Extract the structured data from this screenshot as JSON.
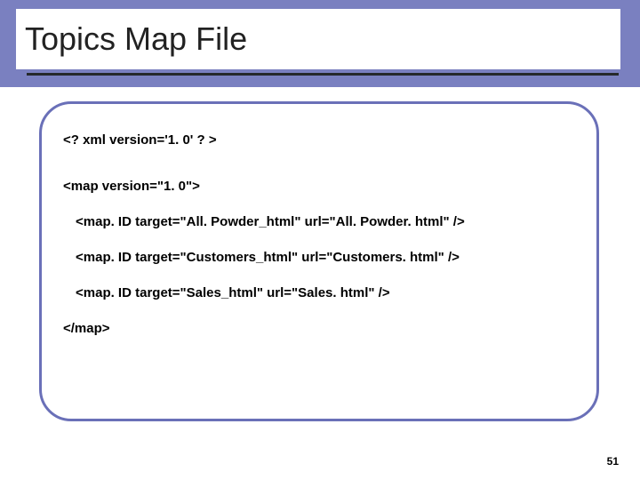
{
  "slide": {
    "title": "Topics Map File",
    "page_number": "51"
  },
  "code": {
    "l1": "<? xml version='1. 0' ? >",
    "l2": "<map version=\"1. 0\">",
    "l3": "<map. ID target=\"All. Powder_html\" url=\"All. Powder. html\" />",
    "l4": "<map. ID target=\"Customers_html\" url=\"Customers. html\" />",
    "l5": "<map. ID target=\"Sales_html\" url=\"Sales. html\" />",
    "l6": "</map>"
  }
}
